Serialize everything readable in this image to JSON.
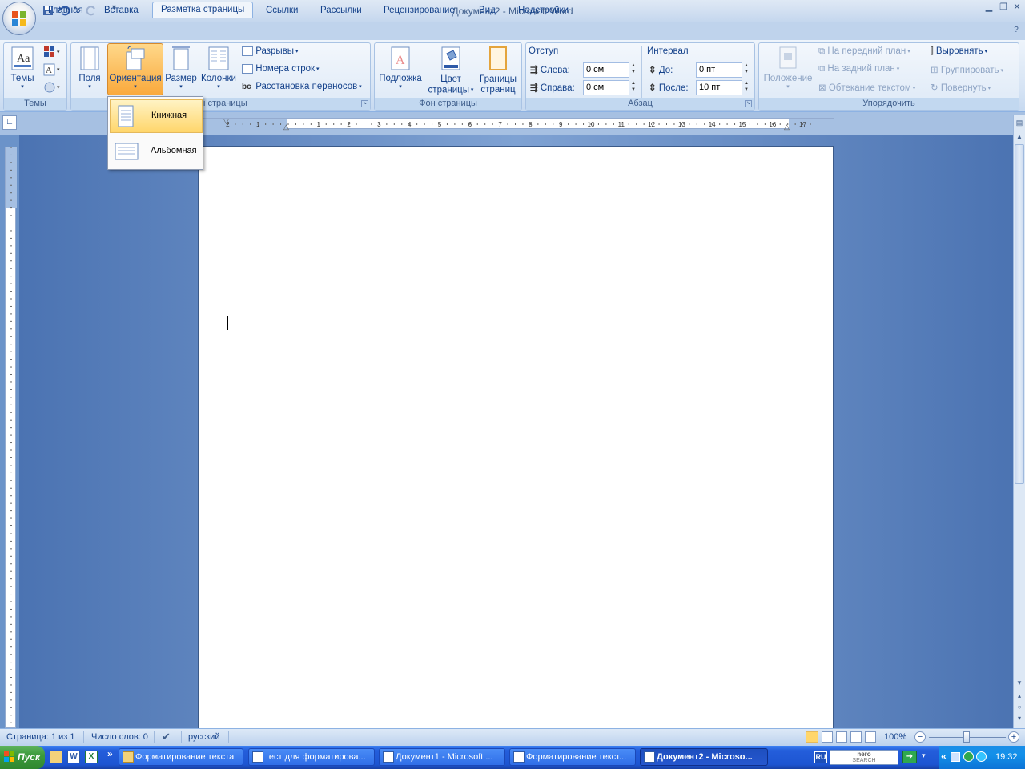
{
  "window": {
    "title": "Документ2 - Microsoft Word"
  },
  "qat": {
    "more": "▾"
  },
  "tabs": [
    "Главная",
    "Вставка",
    "Разметка страницы",
    "Ссылки",
    "Рассылки",
    "Рецензирование",
    "Вид",
    "Надстройки"
  ],
  "ribbon": {
    "themes": {
      "button": "Темы",
      "group": "Темы"
    },
    "page_setup": {
      "fields": "Поля",
      "orientation": "Ориентация",
      "size": "Размер",
      "columns": "Колонки",
      "breaks": "Разрывы",
      "line_numbers": "Номера строк",
      "hyphenation": "Расстановка переносов",
      "group": "ры страницы"
    },
    "page_background": {
      "watermark": "Подложка",
      "color_1": "Цвет",
      "color_2": "страницы",
      "borders_1": "Границы",
      "borders_2": "страниц",
      "group": "Фон страницы"
    },
    "paragraph": {
      "indent_title": "Отступ",
      "left_label": "Слева:",
      "left_value": "0 см",
      "right_label": "Справа:",
      "right_value": "0 см",
      "spacing_title": "Интервал",
      "before_label": "До:",
      "before_value": "0 пт",
      "after_label": "После:",
      "after_value": "10 пт",
      "group": "Абзац"
    },
    "arrange": {
      "position": "Положение",
      "bring_front": "На передний план",
      "send_back": "На задний план",
      "wrap": "Обтекание текстом",
      "align": "Выровнять",
      "group_btn": "Группировать",
      "rotate": "Повернуть",
      "group": "Упорядочить"
    }
  },
  "orientation_menu": {
    "portrait": "Книжная",
    "landscape": "Альбомная"
  },
  "ruler": {
    "h_ticks": [
      "2",
      "1",
      "1",
      "2",
      "3",
      "4",
      "5",
      "6",
      "7",
      "8",
      "9",
      "10",
      "11",
      "12",
      "13",
      "14",
      "15",
      "16",
      "17"
    ]
  },
  "statusbar": {
    "page": "Страница: 1 из 1",
    "words": "Число слов: 0",
    "language": "русский",
    "zoom": "100%"
  },
  "taskbar": {
    "start": "Пуск",
    "items": [
      {
        "label": "Форматирование текста",
        "active": false
      },
      {
        "label": "тест для форматирова...",
        "active": false
      },
      {
        "label": "Документ1 - Microsoft ...",
        "active": false
      },
      {
        "label": "Форматирование текст...",
        "active": false
      },
      {
        "label": "Документ2 - Microso...",
        "active": true
      }
    ],
    "lang": "RU",
    "search_brand": "nero",
    "search_sub": "SEARCH",
    "time": "19:32"
  }
}
